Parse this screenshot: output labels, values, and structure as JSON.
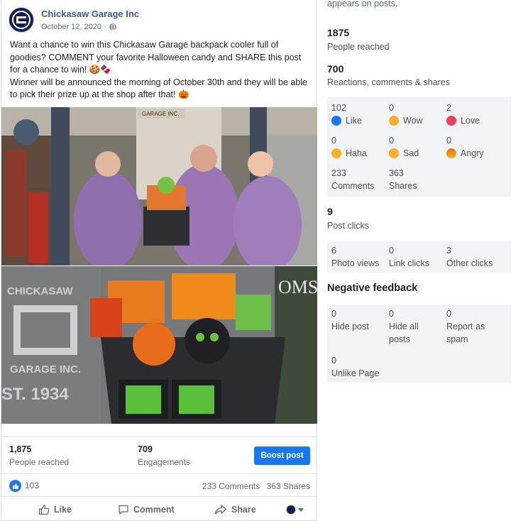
{
  "post": {
    "page_name": "Chickasaw Garage Inc",
    "date": "October 12, 2020 ·",
    "text_lines": [
      "Want a chance to win this Chickasaw Garage backpack cooler full of goodies? COMMENT your favorite Halloween candy and SHARE this post for a chance to win! 🍪🍫",
      "Winner will be announced the morning of October 30th and they will be able to pick their prize up at the shop after that! 🎃"
    ],
    "photo1_sign": "GARAGE INC.",
    "photo2_stone": {
      "line1": "CHICKASAW",
      "line2": "GARAGE INC.",
      "line3": "ST. 1934",
      "edge": "OMS"
    },
    "insights": {
      "reached_value": "1,875",
      "reached_label": "People reached",
      "engagements_value": "709",
      "engagements_label": "Engagements",
      "boost_label": "Boost post"
    },
    "summary": {
      "likes": "103",
      "comments": "233 Comments",
      "shares": "363 Shares"
    },
    "actions": {
      "like": "Like",
      "comment": "Comment",
      "share": "Share"
    }
  },
  "panel": {
    "top_text": "appears on posts.",
    "people_reached": {
      "value": "1875",
      "label": "People reached"
    },
    "reactions_total": {
      "value": "700",
      "label": "Reactions, comments & shares"
    },
    "reactions": [
      {
        "value": "102",
        "label": "Like",
        "icon": "like-icon"
      },
      {
        "value": "0",
        "label": "Wow",
        "icon": "wow-icon"
      },
      {
        "value": "2",
        "label": "Love",
        "icon": "love-icon"
      },
      {
        "value": "0",
        "label": "Haha",
        "icon": "haha-icon"
      },
      {
        "value": "0",
        "label": "Sad",
        "icon": "sad-icon"
      },
      {
        "value": "0",
        "label": "Angry",
        "icon": "angry-icon"
      },
      {
        "value": "233",
        "label": "Comments"
      },
      {
        "value": "363",
        "label": "Shares"
      }
    ],
    "post_clicks": {
      "value": "9",
      "label": "Post clicks"
    },
    "clicks": [
      {
        "value": "6",
        "label": "Photo views"
      },
      {
        "value": "0",
        "label": "Link clicks"
      },
      {
        "value": "3",
        "label": "Other clicks"
      }
    ],
    "negative_title": "Negative feedback",
    "negative": [
      {
        "value": "0",
        "label": "Hide post"
      },
      {
        "value": "0",
        "label": "Hide all posts"
      },
      {
        "value": "0",
        "label": "Report as spam"
      },
      {
        "value": "0",
        "label": "Unlike Page"
      }
    ]
  },
  "colors": {
    "facebook_blue": "#1877f2",
    "link_blue": "#385898",
    "panel_gray": "#f2f3f5"
  }
}
